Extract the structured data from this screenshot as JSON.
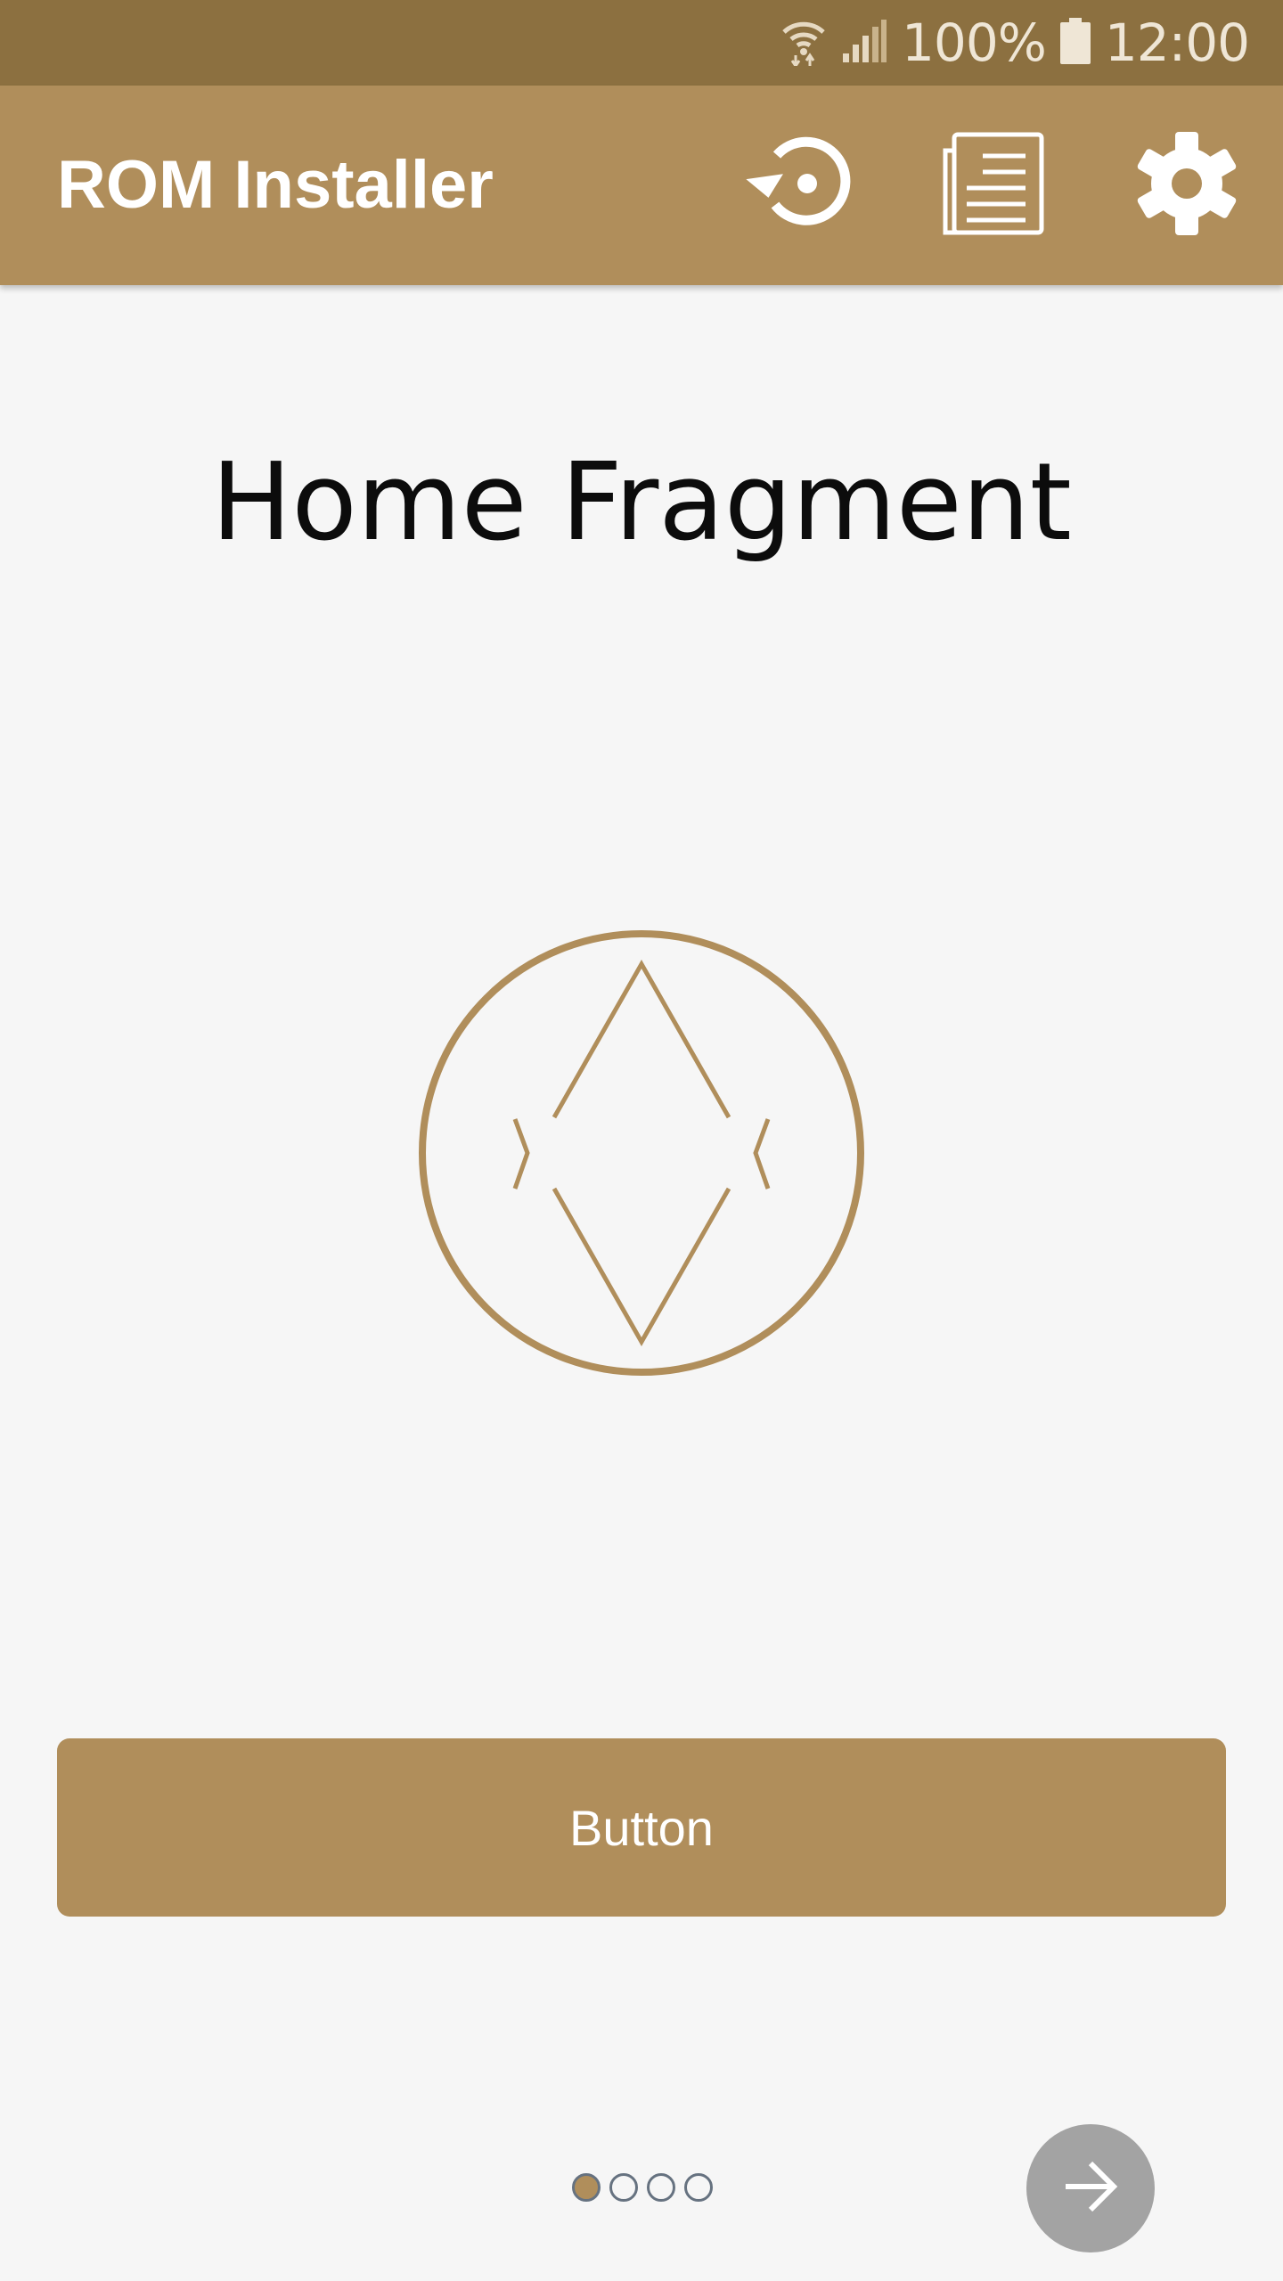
{
  "status_bar": {
    "battery_percent": "100%",
    "time": "12:00",
    "icons": [
      "wifi-icon",
      "signal-icon",
      "battery-icon"
    ]
  },
  "app_bar": {
    "title": "ROM Installer",
    "actions": [
      "restore-icon",
      "log-icon",
      "settings-icon"
    ]
  },
  "content": {
    "title": "Home Fragment",
    "logo": "app-logo",
    "button_label": "Button"
  },
  "pager": {
    "page_count": 4,
    "current_page": 1
  },
  "fab": {
    "icon": "arrow-right-icon"
  },
  "colors": {
    "status_bar": "#8c7040",
    "app_bar": "#b08e5b",
    "accent": "#b08e5b",
    "background": "#f6f6f6",
    "fab": "#a3a3a3"
  }
}
